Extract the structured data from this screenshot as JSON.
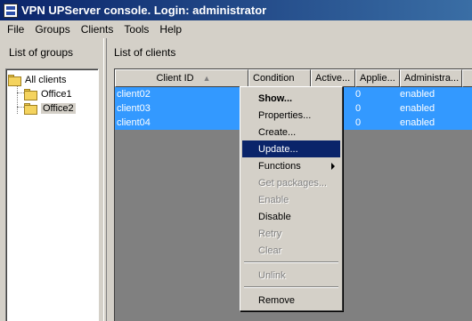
{
  "window": {
    "title": "VPN UPServer console. Login: administrator"
  },
  "menu": [
    "File",
    "Groups",
    "Clients",
    "Tools",
    "Help"
  ],
  "left_pane": {
    "header": "List of groups",
    "tree": {
      "root": "All clients",
      "children": [
        "Office1",
        "Office2"
      ],
      "selected": "Office2"
    }
  },
  "right_pane": {
    "header": "List of clients",
    "columns": [
      "Client ID",
      "Condition",
      "Active...",
      "Applie...",
      "Administra..."
    ],
    "rows": [
      {
        "client_id": "client02",
        "applied": "0",
        "admin_status": "enabled"
      },
      {
        "client_id": "client03",
        "applied": "0",
        "admin_status": "enabled"
      },
      {
        "client_id": "client04",
        "applied": "0",
        "admin_status": "enabled"
      }
    ]
  },
  "context_menu": {
    "items": [
      {
        "label": "Show...",
        "state": "default"
      },
      {
        "label": "Properties...",
        "state": "enabled"
      },
      {
        "label": "Create...",
        "state": "enabled"
      },
      {
        "label": "Update...",
        "state": "highlighted"
      },
      {
        "label": "Functions",
        "state": "submenu"
      },
      {
        "label": "Get packages...",
        "state": "disabled"
      },
      {
        "label": "Enable",
        "state": "disabled"
      },
      {
        "label": "Disable",
        "state": "enabled"
      },
      {
        "label": "Retry",
        "state": "disabled"
      },
      {
        "label": "Clear",
        "state": "disabled"
      },
      {
        "label": "Unlink",
        "state": "disabled"
      },
      {
        "label": "Remove",
        "state": "enabled"
      }
    ]
  },
  "colors": {
    "title_bar": "#0a246a",
    "row_selection": "#3399ff",
    "menu_highlight": "#0a246a",
    "chrome": "#d4d0c8"
  }
}
